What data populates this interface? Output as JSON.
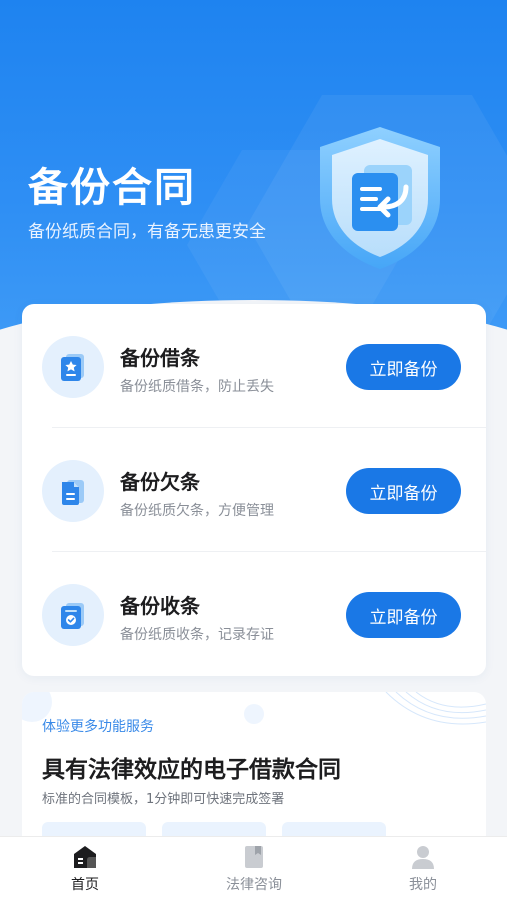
{
  "hero": {
    "title": "备份合同",
    "subtitle": "备份纸质合同，有备无患更安全",
    "shield_icon": "document-return-shield-icon"
  },
  "rows": [
    {
      "title": "备份借条",
      "desc": "备份纸质借条，防止丢失",
      "button": "立即备份",
      "icon": "star-document-icon"
    },
    {
      "title": "备份欠条",
      "desc": "备份纸质欠条，方便管理",
      "button": "立即备份",
      "icon": "document-icon"
    },
    {
      "title": "备份收条",
      "desc": "备份纸质收条，记录存证",
      "button": "立即备份",
      "icon": "check-document-icon"
    }
  ],
  "promo": {
    "tag": "体验更多功能服务",
    "title": "具有法律效应的电子借款合同",
    "desc": "标准的合同模板，1分钟即可快速完成签署"
  },
  "tabbar": {
    "items": [
      {
        "label": "首页",
        "icon": "home-icon",
        "active": true
      },
      {
        "label": "法律咨询",
        "icon": "book-icon",
        "active": false
      },
      {
        "label": "我的",
        "icon": "user-icon",
        "active": false
      }
    ]
  },
  "colors": {
    "primary": "#1a78e6",
    "hero_top": "#1e83f0",
    "icon_bg": "#e4f0fd"
  }
}
